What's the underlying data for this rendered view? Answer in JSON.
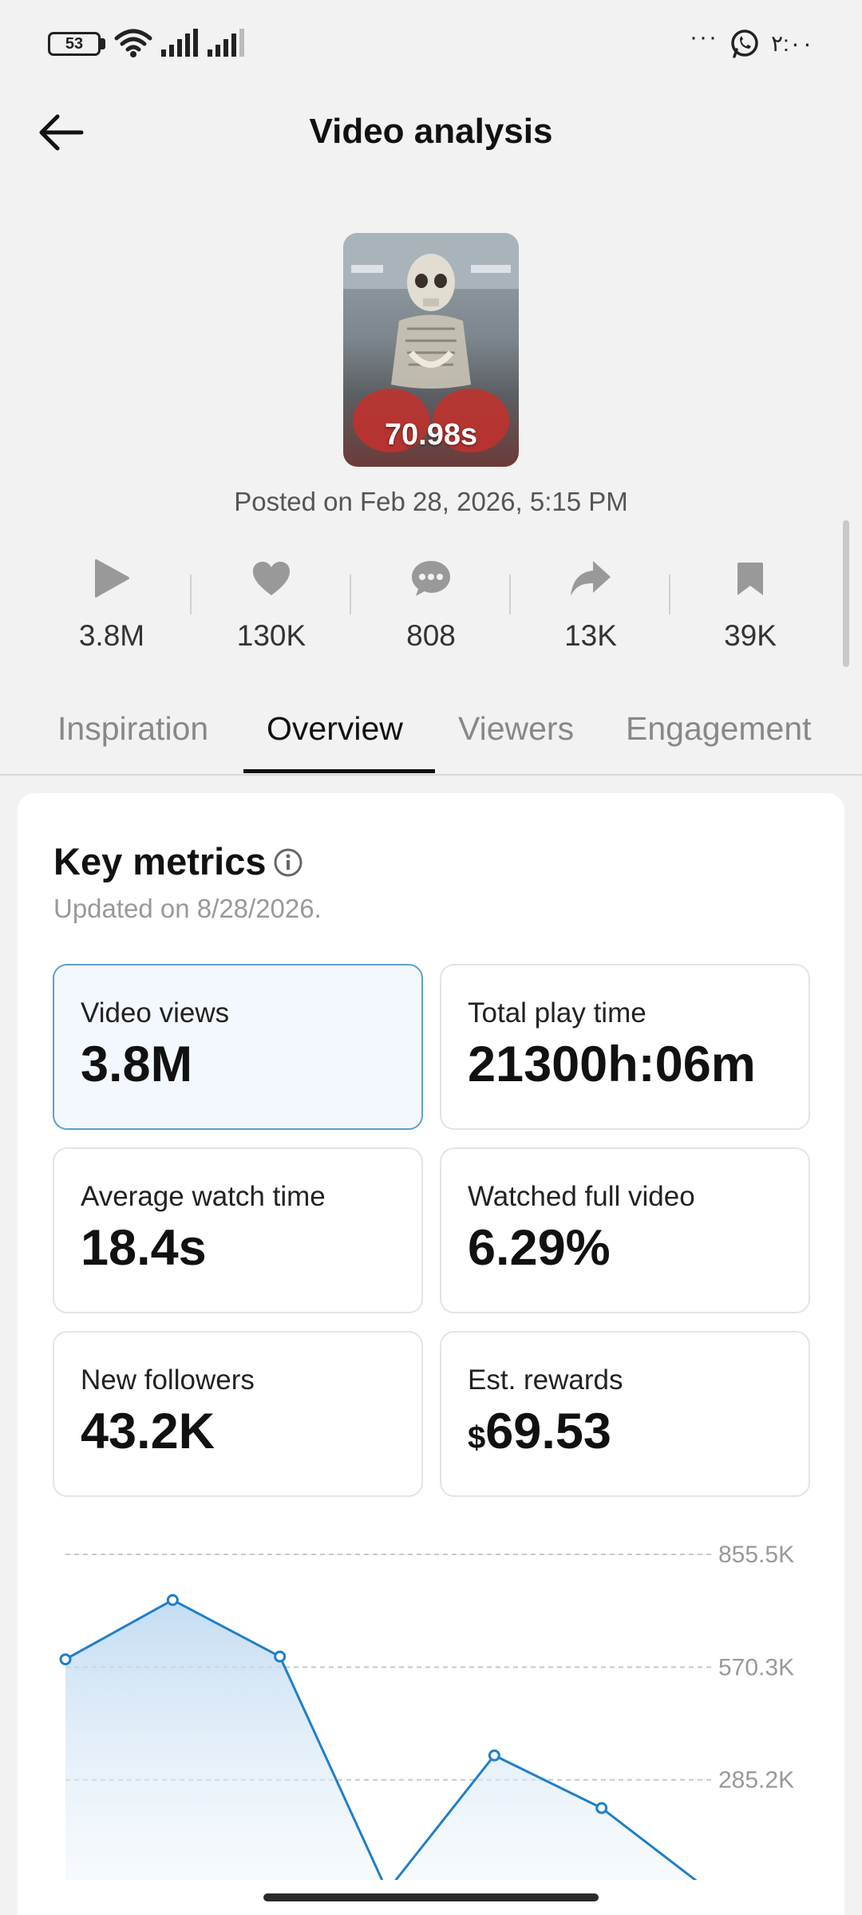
{
  "status_bar": {
    "battery": "53",
    "time": "٢:٠٠",
    "more": "···"
  },
  "header": {
    "title": "Video analysis"
  },
  "video": {
    "duration": "70.98s",
    "posted": "Posted on Feb 28, 2026, 5:15 PM"
  },
  "stats": {
    "views": "3.8M",
    "likes": "130K",
    "comments": "808",
    "shares": "13K",
    "saves": "39K"
  },
  "tabs": [
    "Inspiration",
    "Overview",
    "Viewers",
    "Engagement"
  ],
  "key_metrics": {
    "title": "Key metrics",
    "updated": "Updated on 8/28/2026.",
    "items": [
      {
        "label": "Video views",
        "value": "3.8M"
      },
      {
        "label": "Total play time",
        "value": "21300h:06m"
      },
      {
        "label": "Average watch time",
        "value": "18.4s"
      },
      {
        "label": "Watched full video",
        "value": "6.29%"
      },
      {
        "label": "New followers",
        "value": "43.2K"
      },
      {
        "label": "Est. rewards",
        "currency": "$",
        "value": "69.53"
      }
    ]
  },
  "colors": {
    "accent": "#1f7fc9",
    "selected_border": "#5f9fc6"
  },
  "chart_data": {
    "type": "area",
    "x": [
      1,
      2,
      3,
      4,
      5,
      6,
      7
    ],
    "values": [
      590000,
      740000,
      597000,
      4000,
      347000,
      214000,
      6000
    ],
    "ytick_labels": [
      "855.5K",
      "570.3K",
      "285.2K"
    ],
    "yticks": [
      855500,
      570300,
      285200
    ],
    "ylim": [
      0,
      855500
    ],
    "grid": true
  }
}
